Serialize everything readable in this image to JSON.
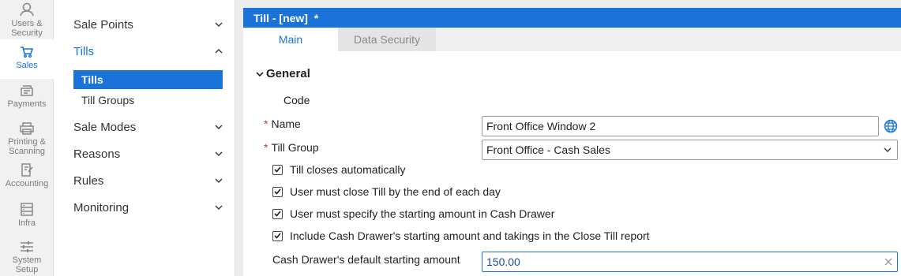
{
  "rail": {
    "items": [
      {
        "label1": "Users &",
        "label2": "Security",
        "icon": "user-icon"
      },
      {
        "label1": "Sales",
        "label2": "",
        "icon": "cart-icon"
      },
      {
        "label1": "Payments",
        "label2": "",
        "icon": "payments-icon"
      },
      {
        "label1": "Printing &",
        "label2": "Scanning",
        "icon": "printer-icon"
      },
      {
        "label1": "Accounting",
        "label2": "",
        "icon": "accounting-icon"
      },
      {
        "label1": "Infra",
        "label2": "",
        "icon": "server-icon"
      },
      {
        "label1": "System",
        "label2": "Setup",
        "icon": "sliders-icon"
      }
    ]
  },
  "nav": {
    "sale_points": "Sale Points",
    "tills": "Tills",
    "tills_sub": "Tills",
    "till_groups": "Till Groups",
    "sale_modes": "Sale Modes",
    "reasons": "Reasons",
    "rules": "Rules",
    "monitoring": "Monitoring"
  },
  "panel": {
    "title": "Till - [new]  *",
    "tab_main": "Main",
    "tab_security": "Data Security",
    "section": "General"
  },
  "form": {
    "code_label": "Code",
    "name_label": "Name",
    "name_value": "Front Office Window 2",
    "till_group_label": "Till Group",
    "till_group_value": "Front Office - Cash Sales",
    "chk1": "Till closes automatically",
    "chk2": "User must close Till by the end of each day",
    "chk3": "User must specify the starting amount in Cash Drawer",
    "chk4": "Include Cash Drawer's starting amount and takings in the Close Till report",
    "amount_label": "Cash Drawer's default starting amount",
    "amount_value": "150.00",
    "required_mark": "*"
  },
  "colors": {
    "accent": "#1a73d9",
    "required": "#d0312d"
  }
}
